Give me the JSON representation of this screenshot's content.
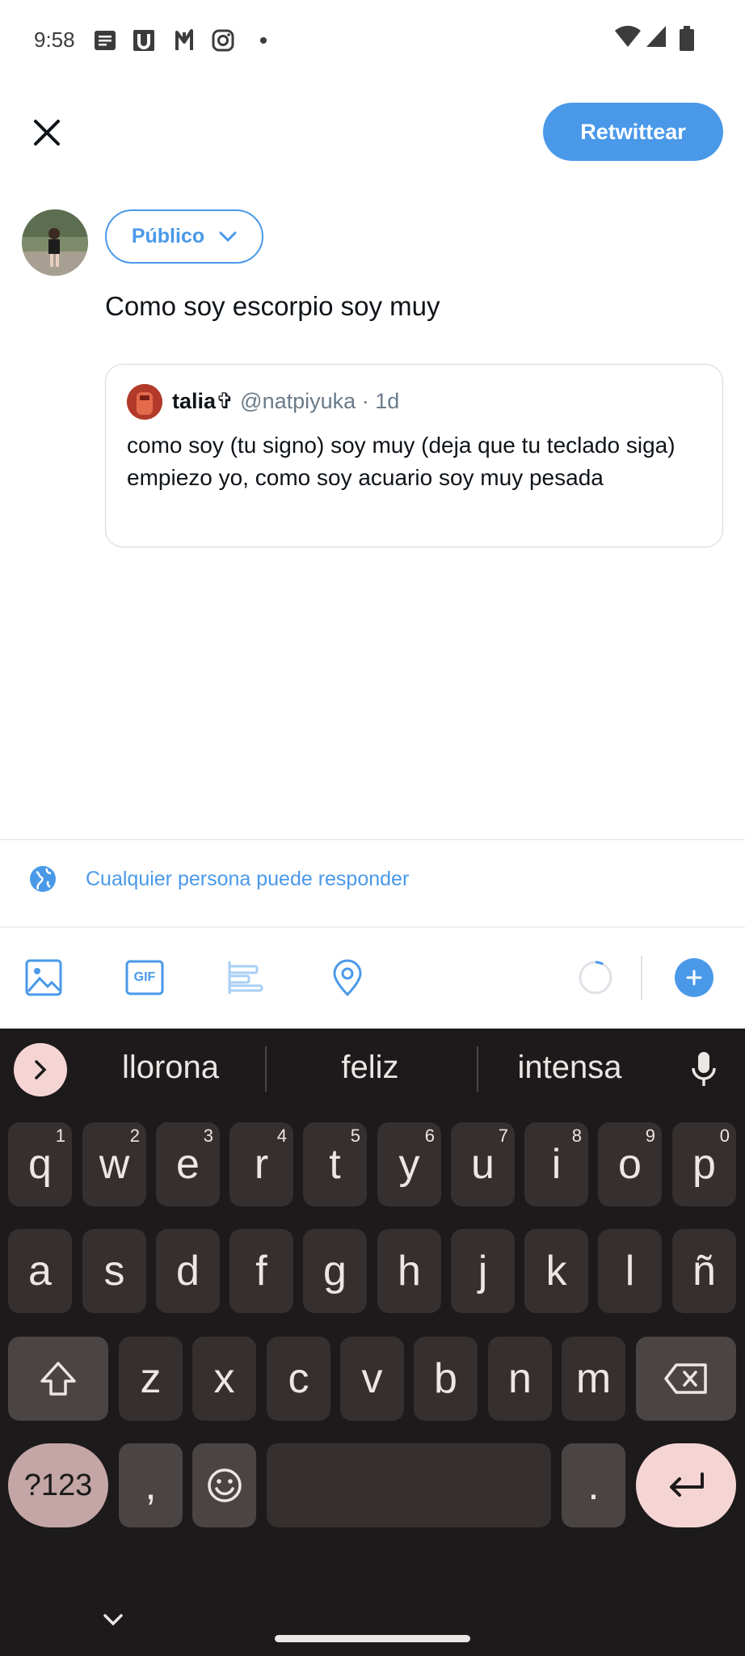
{
  "status_bar": {
    "time": "9:58",
    "left_icons": [
      "notes-icon",
      "u-app-icon",
      "n-app-icon",
      "instagram-icon",
      "dot-icon"
    ],
    "right_icons": [
      "wifi-icon",
      "cellular-signal-icon",
      "battery-icon"
    ]
  },
  "header": {
    "close_icon": "close-icon",
    "retweet_label": "Retwittear"
  },
  "composer": {
    "audience_label": "Público",
    "text": "Como soy escorpio soy muy"
  },
  "quote": {
    "name": "talia✞",
    "handle": "@natpiyuka",
    "separator": "·",
    "time": "1d",
    "body_line1": "como soy (tu signo) soy muy (deja que tu teclado siga)",
    "body_line2": "empiezo yo, como soy acuario soy muy pesada"
  },
  "reply_setting": {
    "label": "Cualquier persona puede responder",
    "icon": "globe-icon"
  },
  "toolbar": {
    "items": [
      "image-icon",
      "gif-icon",
      "poll-icon",
      "location-icon"
    ],
    "gif_label": "GIF",
    "progress_fraction": 0.08
  },
  "keyboard": {
    "suggestions": [
      "llorona",
      "feliz",
      "intensa"
    ],
    "row1": [
      {
        "key": "q",
        "hint": "1"
      },
      {
        "key": "w",
        "hint": "2"
      },
      {
        "key": "e",
        "hint": "3"
      },
      {
        "key": "r",
        "hint": "4"
      },
      {
        "key": "t",
        "hint": "5"
      },
      {
        "key": "y",
        "hint": "6"
      },
      {
        "key": "u",
        "hint": "7"
      },
      {
        "key": "i",
        "hint": "8"
      },
      {
        "key": "o",
        "hint": "9"
      },
      {
        "key": "p",
        "hint": "0"
      }
    ],
    "row2": [
      "a",
      "s",
      "d",
      "f",
      "g",
      "h",
      "j",
      "k",
      "l",
      "ñ"
    ],
    "row3": [
      "z",
      "x",
      "c",
      "v",
      "b",
      "n",
      "m"
    ],
    "symbols_label": "?123",
    "comma_label": ",",
    "period_label": "."
  },
  "colors": {
    "accent": "#4a99e9",
    "keyboard_bg": "#1c1a1a",
    "key_bg": "#35302f",
    "key_special_bg": "#4a4544",
    "symbols_key_bg": "#c4a6a7",
    "enter_key_bg": "#f5d5d4"
  }
}
